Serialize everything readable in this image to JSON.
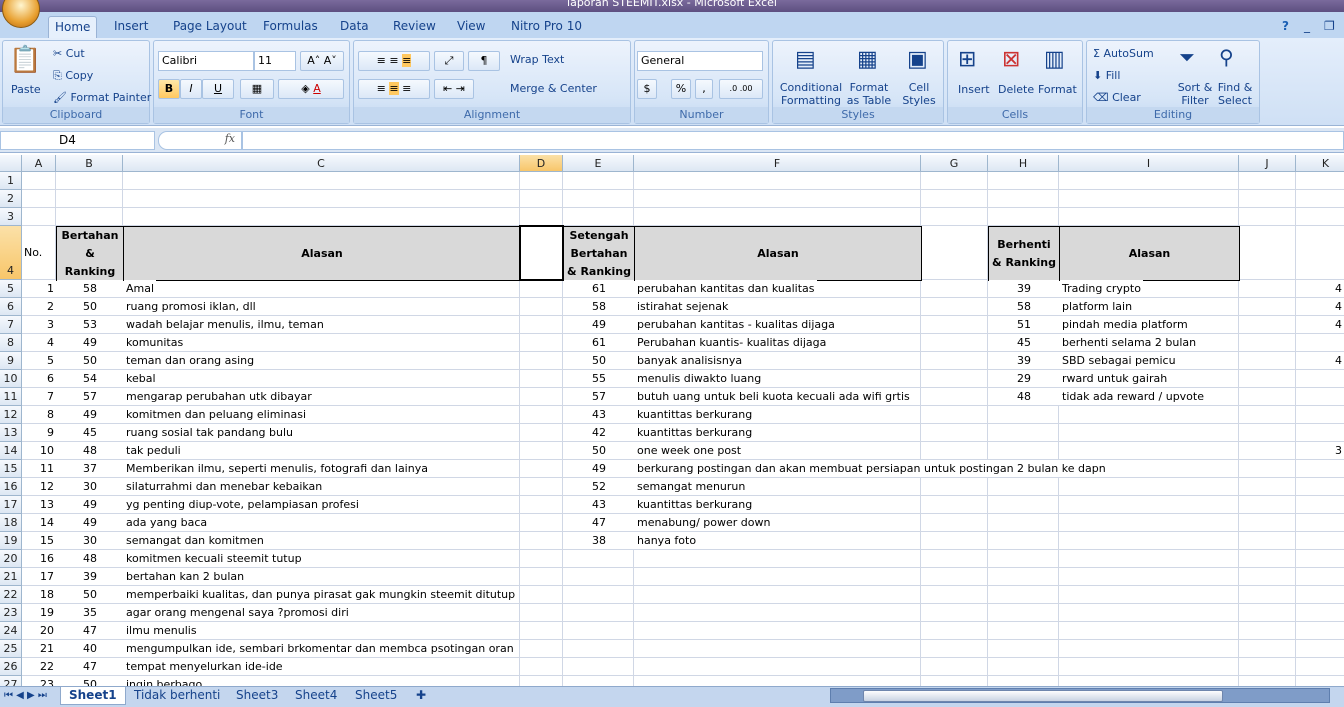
{
  "window": {
    "title": "laporan STEEMIT.xlsx - Microsoft Excel"
  },
  "ribbon_tabs": [
    "Home",
    "Insert",
    "Page Layout",
    "Formulas",
    "Data",
    "Review",
    "View",
    "Nitro Pro 10"
  ],
  "ribbon": {
    "clipboard": {
      "label": "Clipboard",
      "paste": "Paste",
      "cut": "Cut",
      "copy": "Copy",
      "format_painter": "Format Painter"
    },
    "font": {
      "label": "Font",
      "name": "Calibri",
      "size": "11",
      "bold": "B",
      "italic": "I",
      "underline": "U"
    },
    "alignment": {
      "label": "Alignment",
      "wrap": "Wrap Text",
      "merge": "Merge & Center"
    },
    "number": {
      "label": "Number",
      "format": "General",
      "currency": "$",
      "percent": "%",
      "comma": ","
    },
    "styles": {
      "label": "Styles",
      "conditional": "Conditional Formatting",
      "format_table": "Format as Table",
      "cell_styles": "Cell Styles"
    },
    "cells": {
      "label": "Cells",
      "insert": "Insert",
      "delete": "Delete",
      "format": "Format"
    },
    "editing": {
      "label": "Editing",
      "autosum": "AutoSum",
      "fill": "Fill",
      "clear": "Clear",
      "sort": "Sort & Filter",
      "find": "Find & Select"
    }
  },
  "formula_bar": {
    "name_box": "D4",
    "fx": "fx",
    "value": ""
  },
  "columns": [
    "A",
    "B",
    "C",
    "D",
    "E",
    "F",
    "G",
    "H",
    "I",
    "J",
    "K"
  ],
  "selected_cell": "D4",
  "headers": {
    "no": "No.",
    "bertahan": "Bertahan & Ranking",
    "alasan": "Alasan",
    "setengah": "Setengah Bertahan & Ranking",
    "berhenti": "Berhenti & Ranking"
  },
  "bertahan": [
    [
      1,
      58,
      "Amal"
    ],
    [
      2,
      50,
      "ruang promosi iklan, dll"
    ],
    [
      3,
      53,
      "wadah belajar menulis, ilmu, teman"
    ],
    [
      4,
      49,
      "komunitas"
    ],
    [
      5,
      50,
      "teman dan orang asing"
    ],
    [
      6,
      54,
      "kebal"
    ],
    [
      7,
      57,
      "mengarap perubahan utk dibayar"
    ],
    [
      8,
      49,
      "komitmen dan peluang eliminasi"
    ],
    [
      9,
      45,
      "ruang sosial tak pandang bulu"
    ],
    [
      10,
      48,
      "tak peduli"
    ],
    [
      11,
      37,
      "Memberikan ilmu, seperti menulis, fotografi dan lainya"
    ],
    [
      12,
      30,
      "silaturrahmi dan menebar kebaikan"
    ],
    [
      13,
      49,
      "yg penting diup-vote, pelampiasan profesi"
    ],
    [
      14,
      49,
      "ada yang baca"
    ],
    [
      15,
      30,
      "semangat dan komitmen"
    ],
    [
      16,
      48,
      "komitmen kecuali steemit tutup"
    ],
    [
      17,
      39,
      "bertahan kan 2 bulan"
    ],
    [
      18,
      50,
      "memperbaiki kualitas, dan punya pirasat gak mungkin steemit ditutup"
    ],
    [
      19,
      35,
      "agar orang mengenal saya ?promosi diri"
    ],
    [
      20,
      47,
      "ilmu menulis"
    ],
    [
      21,
      40,
      "mengumpulkan ide, sembari brkomentar dan membca psotingan oran"
    ],
    [
      22,
      47,
      "tempat menyelurkan ide-ide"
    ],
    [
      23,
      50,
      "ingin berbago"
    ]
  ],
  "setengah": [
    [
      61,
      "perubahan kantitas dan kualitas"
    ],
    [
      58,
      "istirahat sejenak"
    ],
    [
      49,
      "perubahan kantitas - kualitas dijaga"
    ],
    [
      61,
      "Perubahan kuantis- kualitas dijaga"
    ],
    [
      50,
      "banyak analisisnya"
    ],
    [
      55,
      "menulis diwakto luang"
    ],
    [
      57,
      "butuh uang untuk beli kuota kecuali ada wifi grtis"
    ],
    [
      43,
      "kuantittas berkurang"
    ],
    [
      42,
      "kuantittas berkurang"
    ],
    [
      50,
      "one week one post"
    ],
    [
      49,
      "berkurang postingan dan akan membuat persiapan untuk postingan 2 bulan ke dapn"
    ],
    [
      52,
      "semangat menurun"
    ],
    [
      43,
      "kuantittas berkurang"
    ],
    [
      47,
      "menabung/ power down"
    ],
    [
      38,
      "hanya foto"
    ]
  ],
  "berhenti": [
    [
      39,
      "Trading crypto"
    ],
    [
      58,
      "platform lain"
    ],
    [
      51,
      "pindah media platform"
    ],
    [
      45,
      "berhenti selama 2 bulan"
    ],
    [
      39,
      "SBD sebagai pemicu"
    ],
    [
      29,
      "rward untuk gairah"
    ],
    [
      48,
      "tidak ada reward / upvote"
    ]
  ],
  "col_k": {
    "5": "4",
    "6": "4",
    "7": "4",
    "9": "4",
    "14": "3"
  },
  "sheet_tabs": [
    "Sheet1",
    "Tidak berhenti",
    "Sheet3",
    "Sheet4",
    "Sheet5"
  ],
  "active_sheet": "Sheet1"
}
